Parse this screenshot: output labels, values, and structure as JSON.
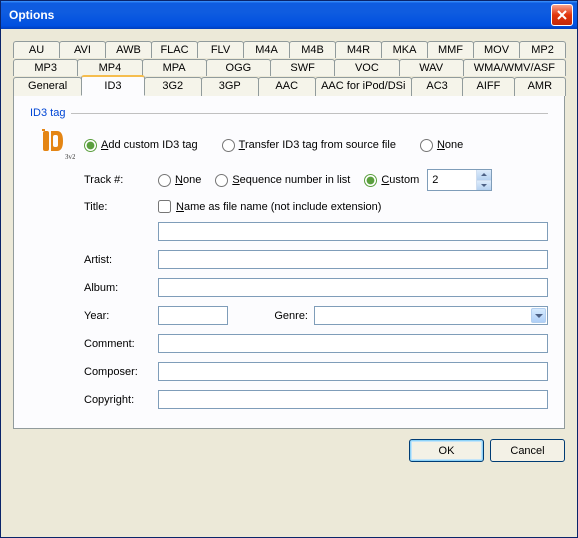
{
  "window": {
    "title": "Options"
  },
  "tab_rows": {
    "row1": [
      "AU",
      "AVI",
      "AWB",
      "FLAC",
      "FLV",
      "M4A",
      "M4B",
      "M4R",
      "MKA",
      "MMF",
      "MOV",
      "MP2"
    ],
    "row2": [
      "MP3",
      "MP4",
      "MPA",
      "OGG",
      "SWF",
      "VOC",
      "WAV",
      "WMA/WMV/ASF"
    ],
    "row3": [
      "General",
      "ID3",
      "3G2",
      "3GP",
      "AAC",
      "AAC for iPod/DSi",
      "AC3",
      "AIFF",
      "AMR"
    ]
  },
  "group": {
    "label": "ID3 tag"
  },
  "mode": {
    "add_prefix": "A",
    "add": "dd custom ID3 tag",
    "transfer_prefix": "T",
    "transfer": "ransfer ID3 tag from source file",
    "none_prefix": "N",
    "none": "one"
  },
  "track": {
    "label": "Track #:",
    "none_prefix": "N",
    "none": "one",
    "seq_prefix": "S",
    "seq": "equence number in list",
    "cust_prefix": "C",
    "cust": "ustom",
    "value": "2"
  },
  "fields": {
    "title": "Title:",
    "name_as_prefix": "N",
    "name_as": "ame as file name (not include extension)",
    "artist": "Artist:",
    "album": "Album:",
    "year": "Year:",
    "genre": "Genre:",
    "comment": "Comment:",
    "composer": "Composer:",
    "copyright": "Copyright:"
  },
  "buttons": {
    "ok": "OK",
    "cancel": "Cancel"
  }
}
